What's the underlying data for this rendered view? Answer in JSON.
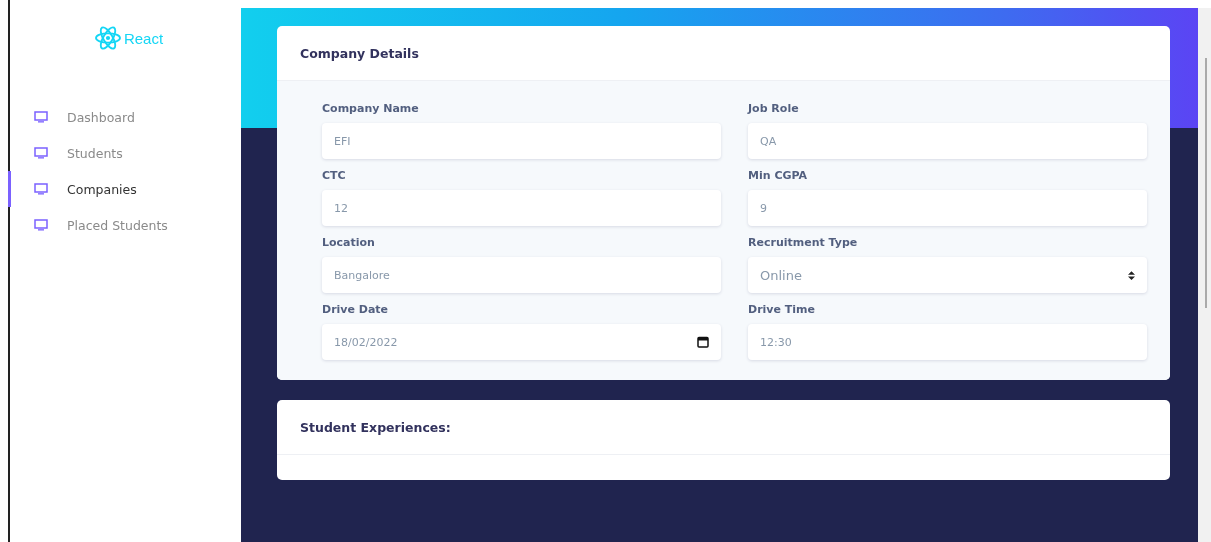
{
  "logo": {
    "text": "React"
  },
  "sidebar": {
    "items": [
      {
        "label": "Dashboard",
        "selected": false
      },
      {
        "label": "Students",
        "selected": false
      },
      {
        "label": "Companies",
        "selected": true
      },
      {
        "label": "Placed Students",
        "selected": false
      }
    ]
  },
  "company_details": {
    "title": "Company Details",
    "fields": [
      {
        "label": "Company Name",
        "kind": "text",
        "value": "EFI"
      },
      {
        "label": "Job Role",
        "kind": "text",
        "value": "QA"
      },
      {
        "label": "CTC",
        "kind": "text",
        "value": "12"
      },
      {
        "label": "Min CGPA",
        "kind": "text",
        "value": "9"
      },
      {
        "label": "Location",
        "kind": "text",
        "value": "Bangalore"
      },
      {
        "label": "Recruitment Type",
        "kind": "select",
        "value": "Online"
      },
      {
        "label": "Drive Date",
        "kind": "date",
        "value": "18/02/2022"
      },
      {
        "label": "Drive Time",
        "kind": "text",
        "value": "12:30"
      }
    ]
  },
  "student_experiences": {
    "title": "Student Experiences:"
  }
}
